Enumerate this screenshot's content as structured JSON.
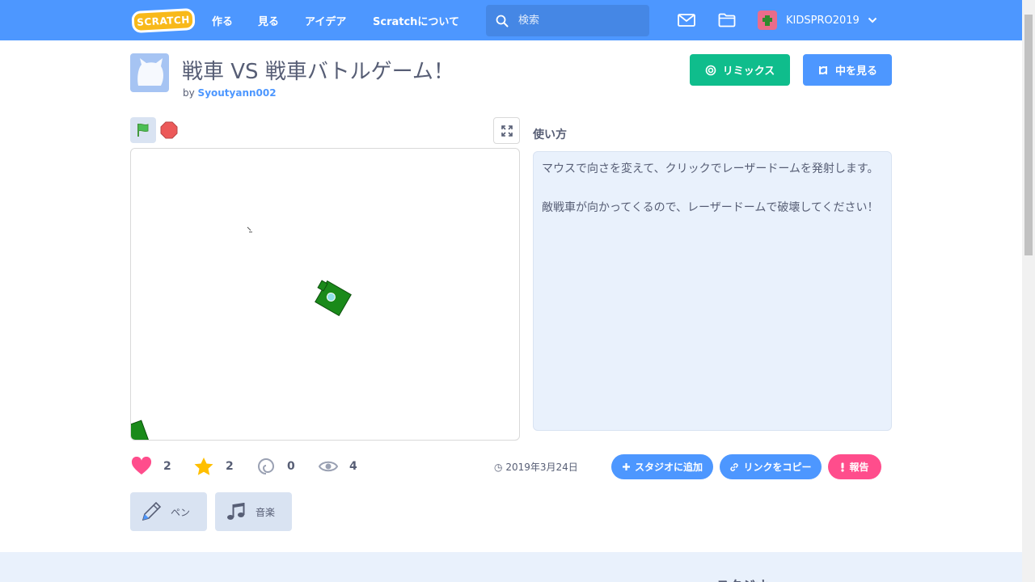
{
  "nav": {
    "logo": "SCRATCH",
    "create": "作る",
    "explore": "見る",
    "ideas": "アイデア",
    "about": "Scratchについて",
    "search_placeholder": "検索",
    "username": "KIDSPRO2019"
  },
  "project": {
    "title": "戦車 VS 戦車バトルゲーム！",
    "by": "by",
    "author": "Syoutyann002",
    "remix_label": "リミックス",
    "see_inside_label": "中を見る"
  },
  "instructions": {
    "heading": "使い方",
    "text": "マウスで向さを変えて、クリックでレーザードームを発射します。\n\n敵戦車が向かってくるので、レーザードームで破壊してください！"
  },
  "stats": {
    "loves": "2",
    "favorites": "2",
    "remixes": "0",
    "views": "4",
    "date": "2019年3月24日"
  },
  "actions": {
    "add_to_studio": "スタジオに追加",
    "copy_link": "リンクをコピー",
    "report": "報告"
  },
  "extensions": {
    "pen": "ペン",
    "music": "音楽"
  },
  "footer": {
    "studios_heading": "スタジオ"
  },
  "colors": {
    "nav_blue": "#4d97ff",
    "remix_green": "#0fbd8c",
    "report_pink": "#ff4d8c",
    "tank_green": "#1a8a1a"
  }
}
